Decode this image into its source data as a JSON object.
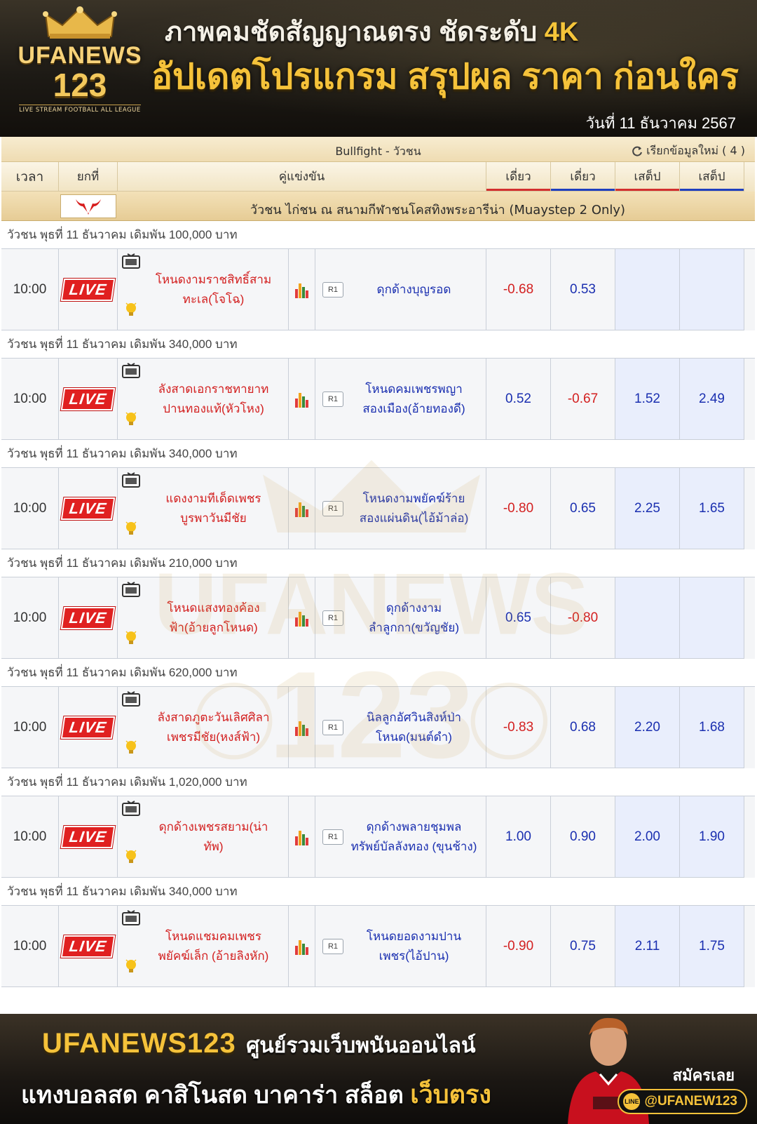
{
  "banner": {
    "logo_name": "UFANEWS",
    "logo_num": "123",
    "logo_tag": "LIVE STREAM FOOTBALL ALL LEAGUE",
    "headline1_a": "ภาพคมชัดสัญญาณตรง ชัดระดับ ",
    "headline1_b": "4K",
    "headline2": "อัปเดตโปรแกรม สรุปผล ราคา ก่อนใคร",
    "date": "วันที่  11 ธันวาคม 2567"
  },
  "table": {
    "title": "Bullfight - วัวชน",
    "refresh_label": "เรียกข้อมูลใหม่ ( 4 )",
    "headers": {
      "time": "เวลา",
      "round": "ยกที่",
      "match": "คู่แข่งขัน",
      "odd1": "เดี่ยว",
      "odd2": "เดี่ยว",
      "odd3": "เสต็ป",
      "odd4": "เสต็ป"
    },
    "league": "วัวชน ไก่ชน ณ สนามกีฬาชนโคสทิงพระอารีน่า (Muaystep 2 Only)",
    "live_label": "LIVE",
    "round_label": "R1",
    "matches": [
      {
        "info": "วัวชน พุธที่ 11 ธันวาคม เดิมพัน 100,000 บาท",
        "time": "10:00",
        "home": [
          "โหนดงามราชสิทธิ์สาม",
          "ทะเล(โจโฉ)"
        ],
        "away": [
          "ดุกด้างบุญรอด"
        ],
        "o1": "-0.68",
        "o2": "0.53",
        "o3": "",
        "o4": ""
      },
      {
        "info": "วัวชน พุธที่ 11 ธันวาคม เดิมพัน 340,000 บาท",
        "time": "10:00",
        "home": [
          "ลังสาดเอกราชทายาท",
          "ปานทองแท้(หัวโหง)"
        ],
        "away": [
          "โหนดคมเพชรพญา",
          "สองเมือง(อ้ายทองดี)"
        ],
        "o1": "0.52",
        "o2": "-0.67",
        "o3": "1.52",
        "o4": "2.49"
      },
      {
        "info": "วัวชน พุธที่ 11 ธันวาคม เดิมพัน 340,000 บาท",
        "time": "10:00",
        "home": [
          "แดงงามทีเด็ดเพชร",
          "บูรพาวันมีชัย"
        ],
        "away": [
          "โหนดงามพยัคฆ์ร้าย",
          "สองแผ่นดิน(ไอ้ม้าล่อ)"
        ],
        "o1": "-0.80",
        "o2": "0.65",
        "o3": "2.25",
        "o4": "1.65"
      },
      {
        "info": "วัวชน พุธที่ 11 ธันวาคม เดิมพัน 210,000 บาท",
        "time": "10:00",
        "home": [
          "โหนดแสงทองค้อง",
          "ฟ้า(อ้ายลูกโหนด)"
        ],
        "away": [
          "ดุกด้างงาม",
          "ลำลูกกา(ขวัญชัย)"
        ],
        "o1": "0.65",
        "o2": "-0.80",
        "o3": "",
        "o4": ""
      },
      {
        "info": "วัวชน พุธที่ 11 ธันวาคม เดิมพัน 620,000 บาท",
        "time": "10:00",
        "home": [
          "ลังสาดภูตะวันเลิศศิลา",
          "เพชรมีชัย(หงส์ฟ้า)"
        ],
        "away": [
          "นิลลูกอัศวินสิงห์ป่า",
          "โหนด(มนต์ดำ)"
        ],
        "o1": "-0.83",
        "o2": "0.68",
        "o3": "2.20",
        "o4": "1.68"
      },
      {
        "info": "วัวชน พุธที่ 11 ธันวาคม เดิมพัน 1,020,000 บาท",
        "time": "10:00",
        "home": [
          "ดุกด้างเพชรสยาม(น่า",
          "ทัพ)"
        ],
        "away": [
          "ดุกด้างพลายชุมพล",
          "ทรัพย์บัลลังทอง (ขุนช้าง)"
        ],
        "o1": "1.00",
        "o2": "0.90",
        "o3": "2.00",
        "o4": "1.90"
      },
      {
        "info": "วัวชน พุธที่ 11 ธันวาคม เดิมพัน 340,000 บาท",
        "time": "10:00",
        "home": [
          "โหนดแชมคมเพชร",
          "พยัคฆ์เล็ก (อ้ายลิงหัก)"
        ],
        "away": [
          "โหนดยอดงามปาน",
          "เพชร(ไอ้ปาน)"
        ],
        "o1": "-0.90",
        "o2": "0.75",
        "o3": "2.11",
        "o4": "1.75"
      }
    ]
  },
  "footer": {
    "brand": "UFANEWS123",
    "tagline": "ศูนย์รวมเว็บพนันออนไลน์",
    "line2": "แทงบอลสด คาสิโนสด บาคาร่า สล็อต ",
    "line2_gold": "เว็บตรง",
    "signup": "สมัครเลย",
    "line_id": "@UFANEW123"
  },
  "colors": {
    "accent_gold": "#f5c23a",
    "live_red": "#e02020",
    "neg_red": "#d32020",
    "pos_blue": "#1a2fb0"
  }
}
